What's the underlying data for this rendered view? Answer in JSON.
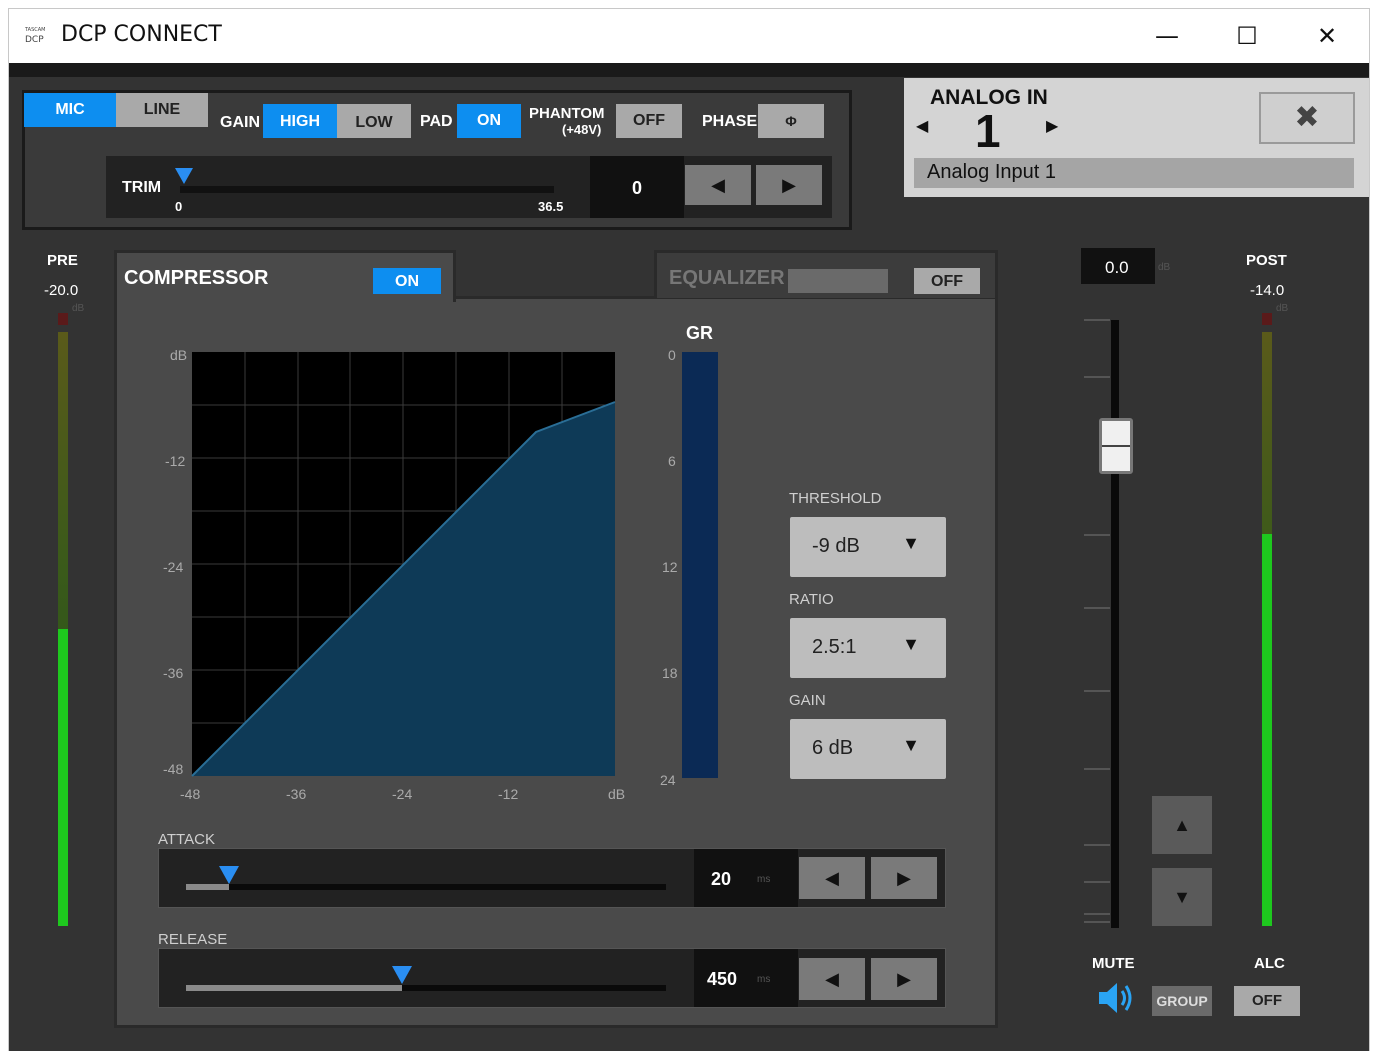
{
  "window": {
    "title": "DCP CONNECT",
    "logo_top": "TASCAM",
    "logo_bottom": "DCP",
    "minimize": "—",
    "maximize": "☐",
    "close": "✕"
  },
  "input": {
    "mic": "MIC",
    "line": "LINE",
    "gain_label": "GAIN",
    "gain_high": "HIGH",
    "gain_low": "LOW",
    "pad_label": "PAD",
    "pad_value": "ON",
    "phantom_label": "PHANTOM",
    "phantom_sub": "(+48V)",
    "phantom_value": "OFF",
    "phase_label": "PHASE",
    "phase_value": "Φ",
    "trim_label": "TRIM",
    "trim_min": "0",
    "trim_max": "36.5",
    "trim_value": "0"
  },
  "channel": {
    "header": "ANALOG IN",
    "number": "1",
    "name": "Analog Input 1",
    "close": "✖"
  },
  "pre": {
    "label": "PRE",
    "value": "-20.0",
    "unit": "dB",
    "level": 0.5
  },
  "post": {
    "label": "POST",
    "value": "-14.0",
    "unit": "dB",
    "level": 0.66
  },
  "compressor": {
    "tab": "COMPRESSOR",
    "state": "ON",
    "graph": {
      "y_unit": "dB",
      "x_unit": "dB",
      "y_ticks": [
        "-12",
        "-24",
        "-36",
        "-48"
      ],
      "x_ticks": [
        "-48",
        "-36",
        "-24",
        "-12"
      ]
    },
    "gr": {
      "label": "GR",
      "ticks": [
        "0",
        "6",
        "12",
        "18",
        "24"
      ]
    },
    "threshold": {
      "label": "THRESHOLD",
      "value": "-9 dB"
    },
    "ratio": {
      "label": "RATIO",
      "value": "2.5:1"
    },
    "gain": {
      "label": "GAIN",
      "value": "6 dB"
    },
    "attack": {
      "label": "ATTACK",
      "value": "20",
      "unit": "ms",
      "level": 0.09
    },
    "release": {
      "label": "RELEASE",
      "value": "450",
      "unit": "ms",
      "level": 0.45
    }
  },
  "equalizer": {
    "tab": "EQUALIZER",
    "state": "OFF"
  },
  "fader": {
    "value": "0.0",
    "unit": "dB",
    "up": "▲",
    "down": "▼"
  },
  "bottom": {
    "mute": "MUTE",
    "group": "GROUP",
    "alc": "ALC",
    "alc_value": "OFF"
  },
  "arrows": {
    "left": "◀",
    "right": "▶",
    "tri_down": "▼"
  }
}
